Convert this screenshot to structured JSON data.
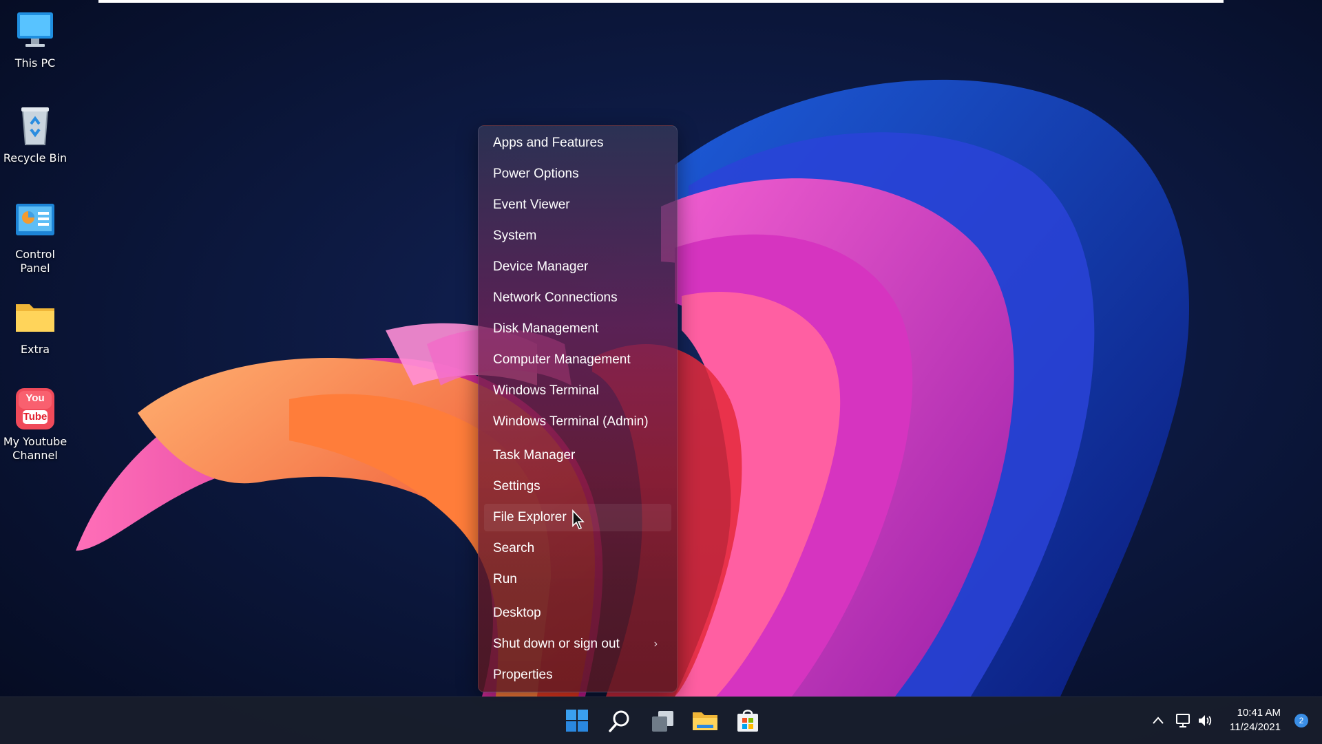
{
  "desktop": {
    "icons": [
      {
        "label": "This PC",
        "icon": "monitor-icon"
      },
      {
        "label": "Recycle Bin",
        "icon": "recycle-bin-icon"
      },
      {
        "label": "Control Panel",
        "icon": "control-panel-icon"
      },
      {
        "label": "Extra",
        "icon": "folder-icon"
      },
      {
        "label": "My Youtube Channel",
        "icon": "youtube-icon",
        "badge_top": "You",
        "badge_bottom": "Tube"
      }
    ]
  },
  "context_menu": {
    "items": [
      {
        "label": "Apps and Features"
      },
      {
        "label": "Power Options"
      },
      {
        "label": "Event Viewer"
      },
      {
        "label": "System"
      },
      {
        "label": "Device Manager"
      },
      {
        "label": "Network Connections"
      },
      {
        "label": "Disk Management"
      },
      {
        "label": "Computer Management"
      },
      {
        "label": "Windows Terminal"
      },
      {
        "label": "Windows Terminal (Admin)"
      },
      {
        "label": "Task Manager"
      },
      {
        "label": "Settings"
      },
      {
        "label": "File Explorer"
      },
      {
        "label": "Search"
      },
      {
        "label": "Run"
      },
      {
        "label": "Desktop"
      },
      {
        "label": "Shut down or sign out",
        "submenu_icon": "chevron-right-icon",
        "chevron": "›"
      },
      {
        "label": "Properties"
      }
    ],
    "hovered_item": "File Explorer"
  },
  "taskbar": {
    "buttons": [
      "start-icon",
      "search-icon",
      "task-view-icon",
      "file-explorer-icon",
      "microsoft-store-icon"
    ],
    "tray": {
      "icons": [
        "chevron-up-icon",
        "network-icon",
        "volume-icon"
      ],
      "time": "10:41 AM",
      "date": "11/24/2021",
      "notification_count": "2"
    }
  },
  "colors": {
    "accent": "#3a8ee6",
    "taskbar": "#181e2c",
    "background": "#061029"
  }
}
